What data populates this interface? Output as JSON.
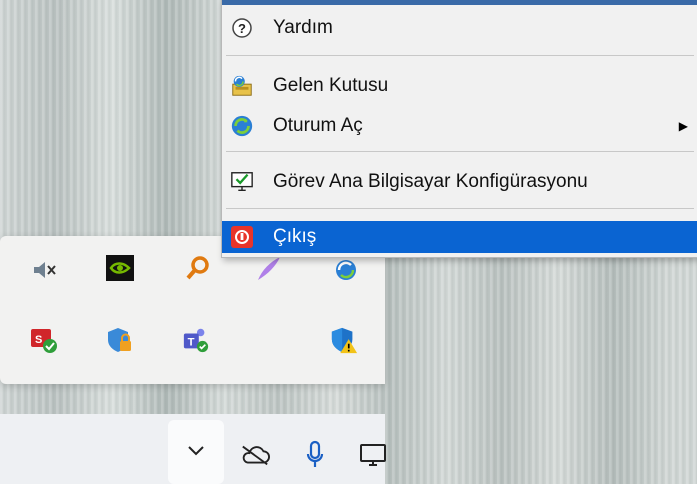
{
  "context_menu": {
    "items": [
      {
        "label": "Yardım",
        "icon": "help-icon"
      },
      {
        "label": "Gelen Kutusu",
        "icon": "inbox-icon"
      },
      {
        "label": "Oturum Aç",
        "icon": "login-icon",
        "has_submenu": true
      },
      {
        "label": "Görev Ana Bilgisayar Konfigürasyonu",
        "icon": "host-config-icon"
      },
      {
        "label": "Çıkış",
        "icon": "exit-icon",
        "selected": true
      }
    ],
    "submenu_arrow": "▶"
  },
  "tray_flyout": {
    "icons": [
      "speaker-muted-icon",
      "nvidia-icon",
      "search-key-icon",
      "feather-icon",
      "sync-icon",
      "security-app-icon",
      "shield-lock-icon",
      "teams-icon",
      "defender-warning-icon"
    ]
  },
  "taskbar": {
    "icons": [
      "chevron-up-icon",
      "onedrive-offline-icon",
      "microphone-icon",
      "display-icon"
    ]
  },
  "colors": {
    "selection": "#0a64d2",
    "menu_bg": "#f1f1f1",
    "flyout_bg": "#f2f2f1"
  }
}
